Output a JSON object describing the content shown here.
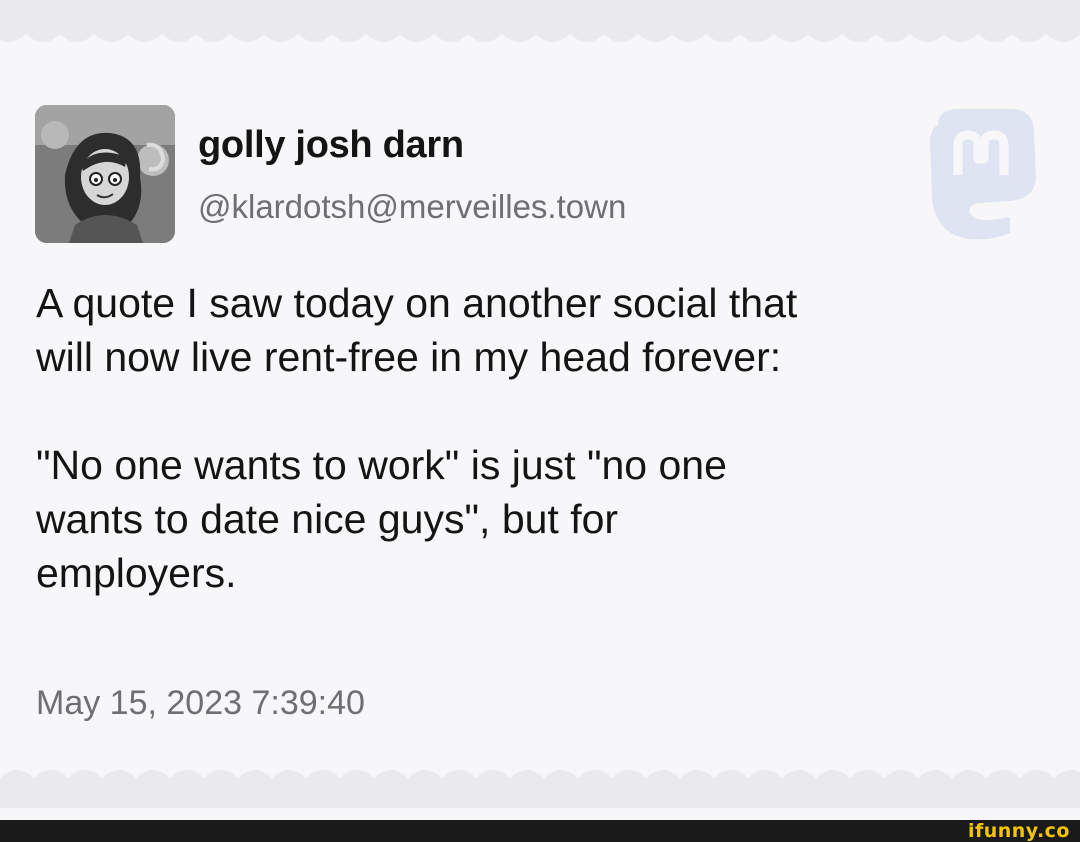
{
  "post": {
    "display_name": "golly josh darn",
    "handle": "@klardotsh@merveilles.town",
    "paragraph_1": "A quote I saw today on another social that\nwill now live rent-free in my head forever:",
    "paragraph_2": "\"No one wants to work\" is just \"no one\nwants to date nice guys\", but for\nemployers.",
    "timestamp": "May 15, 2023 7:39:40"
  },
  "icons": {
    "avatar": "cartoon-character-avatar",
    "platform_logo": "mastodon-logo"
  },
  "watermark": {
    "text": "ifunny.co"
  },
  "colors": {
    "background": "#f7f7f9",
    "text": "#141414",
    "muted_text": "#6e6e74",
    "logo_tint": "#dfe4f3",
    "watermark": "#f2c500"
  }
}
